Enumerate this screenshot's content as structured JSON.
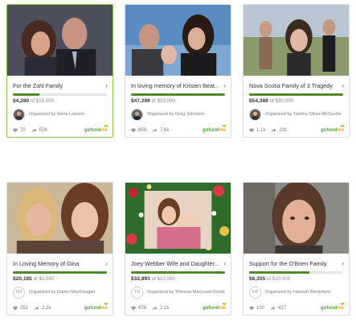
{
  "cards": [
    {
      "title": "For the Zahl Family",
      "raised": "$4,280",
      "goal": "of $15,000",
      "progress": 0.285,
      "organizer": "Organized by Gena Lawson",
      "avatar_initials": "",
      "likes": "70",
      "shares": "526",
      "brand": "gofundme",
      "highlighted": true
    },
    {
      "title": "In loving memory of Kristen Beat...",
      "raised": "$47,299",
      "goal": "of $20,000",
      "progress": 1.0,
      "organizer": "Organized by Greg Johnston",
      "avatar_initials": "",
      "likes": "859",
      "shares": "7.6k",
      "brand": "gofundme",
      "highlighted": false
    },
    {
      "title": "Nova Scotia Family of 3 Tragedy",
      "raised": "$54,389",
      "goal": "of $30,000",
      "progress": 1.0,
      "organizer": "Organized by Tammy Oliver-McCurdie",
      "avatar_initials": "",
      "likes": "1.1k",
      "shares": "21k",
      "brand": "gofundme",
      "highlighted": false
    },
    {
      "title": "In Loving Memory of Gina",
      "raised": "$20,185",
      "goal": "of $3,000",
      "progress": 1.0,
      "organizer": "Organized by Daniel MacDougall",
      "avatar_initials": "DM",
      "likes": "252",
      "shares": "2.2k",
      "brand": "gofundme",
      "highlighted": false
    },
    {
      "title": "Joey Webber Wife and Daughter...",
      "raised": "$32,893",
      "goal": "of $10,000",
      "progress": 1.0,
      "organizer": "Organized by Theresa MacLeod-Gould",
      "avatar_initials": "TM",
      "likes": "476",
      "shares": "2.1k",
      "brand": "gofundme",
      "highlighted": false
    },
    {
      "title": "Support for the O'Brien Family",
      "raised": "$6,355",
      "goal": "of $10,000",
      "progress": 0.64,
      "organizer": "Organized by Hannah Blenkhorn",
      "avatar_initials": "HB",
      "likes": "100",
      "shares": "417",
      "brand": "gofundme",
      "highlighted": false
    }
  ],
  "colors": {
    "progress_fill": "#4d8a2a",
    "brand_green": "#52a43a",
    "highlight_border": "#8cc63e"
  }
}
